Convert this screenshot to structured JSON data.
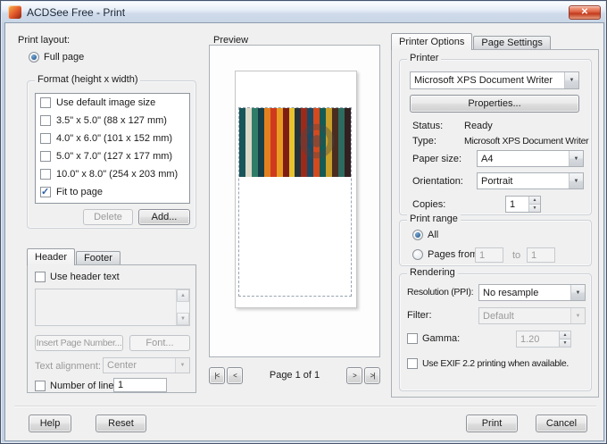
{
  "window": {
    "title": "ACDSee Free - Print",
    "close_glyph": "✕"
  },
  "left": {
    "print_layout_label": "Print layout:",
    "full_page_label": "Full page",
    "format": {
      "title": "Format (height x width)",
      "items": [
        {
          "label": "Use default image size",
          "checked": false
        },
        {
          "label": "3.5\" x 5.0\" (88 x 127 mm)",
          "checked": false
        },
        {
          "label": "4.0\" x 6.0\" (101 x 152 mm)",
          "checked": false
        },
        {
          "label": "5.0\" x 7.0\" (127 x 177 mm)",
          "checked": false
        },
        {
          "label": "10.0\" x 8.0\" (254 x 203 mm)",
          "checked": false
        },
        {
          "label": "Fit to page",
          "checked": true
        }
      ],
      "delete_label": "Delete",
      "add_label": "Add..."
    },
    "header_footer": {
      "tabs": [
        {
          "label": "Header",
          "active": true
        },
        {
          "label": "Footer",
          "active": false
        }
      ],
      "use_header_text_label": "Use header text",
      "insert_page_number_label": "Insert Page Number...",
      "font_label": "Font...",
      "text_alignment_label": "Text alignment:",
      "text_alignment_value": "Center",
      "number_of_lines_label": "Number of lines:",
      "number_of_lines_value": "1"
    }
  },
  "preview": {
    "label": "Preview",
    "page_indicator": "Page 1 of 1",
    "nav_first": "|<",
    "nav_prev": "<",
    "nav_next": ">",
    "nav_last": ">|",
    "stripe_colors": [
      "#17555a",
      "#dcd8c8",
      "#2f7d68",
      "#173f4a",
      "#e2801f",
      "#cf3a1f",
      "#e89b22",
      "#7e1d14",
      "#e7c32e",
      "#24333b",
      "#9c2a1a",
      "#1d4a63",
      "#d44a1e",
      "#155a54",
      "#c8a02a",
      "#4a2c20",
      "#2c6b5f",
      "#321f1f"
    ]
  },
  "right": {
    "tabs": [
      {
        "label": "Printer Options",
        "active": true
      },
      {
        "label": "Page Settings",
        "active": false
      }
    ],
    "printer": {
      "title": "Printer",
      "printer_value": "Microsoft XPS Document Writer",
      "properties_label": "Properties...",
      "status_label": "Status:",
      "status_value": "Ready",
      "type_label": "Type:",
      "type_value": "Microsoft XPS Document Writer",
      "paper_size_label": "Paper size:",
      "paper_size_value": "A4",
      "orientation_label": "Orientation:",
      "orientation_value": "Portrait",
      "copies_label": "Copies:",
      "copies_value": "1"
    },
    "print_range": {
      "title": "Print range",
      "all_label": "All",
      "pages_from_label": "Pages from:",
      "pages_from_value": "1",
      "to_label": "to",
      "pages_to_value": "1"
    },
    "rendering": {
      "title": "Rendering",
      "resolution_label": "Resolution (PPI):",
      "resolution_value": "No resample",
      "filter_label": "Filter:",
      "filter_value": "Default",
      "gamma_label": "Gamma:",
      "gamma_value": "1.20",
      "exif_label": "Use EXIF 2.2 printing when available."
    }
  },
  "footer": {
    "help": "Help",
    "reset": "Reset",
    "print": "Print",
    "cancel": "Cancel"
  }
}
